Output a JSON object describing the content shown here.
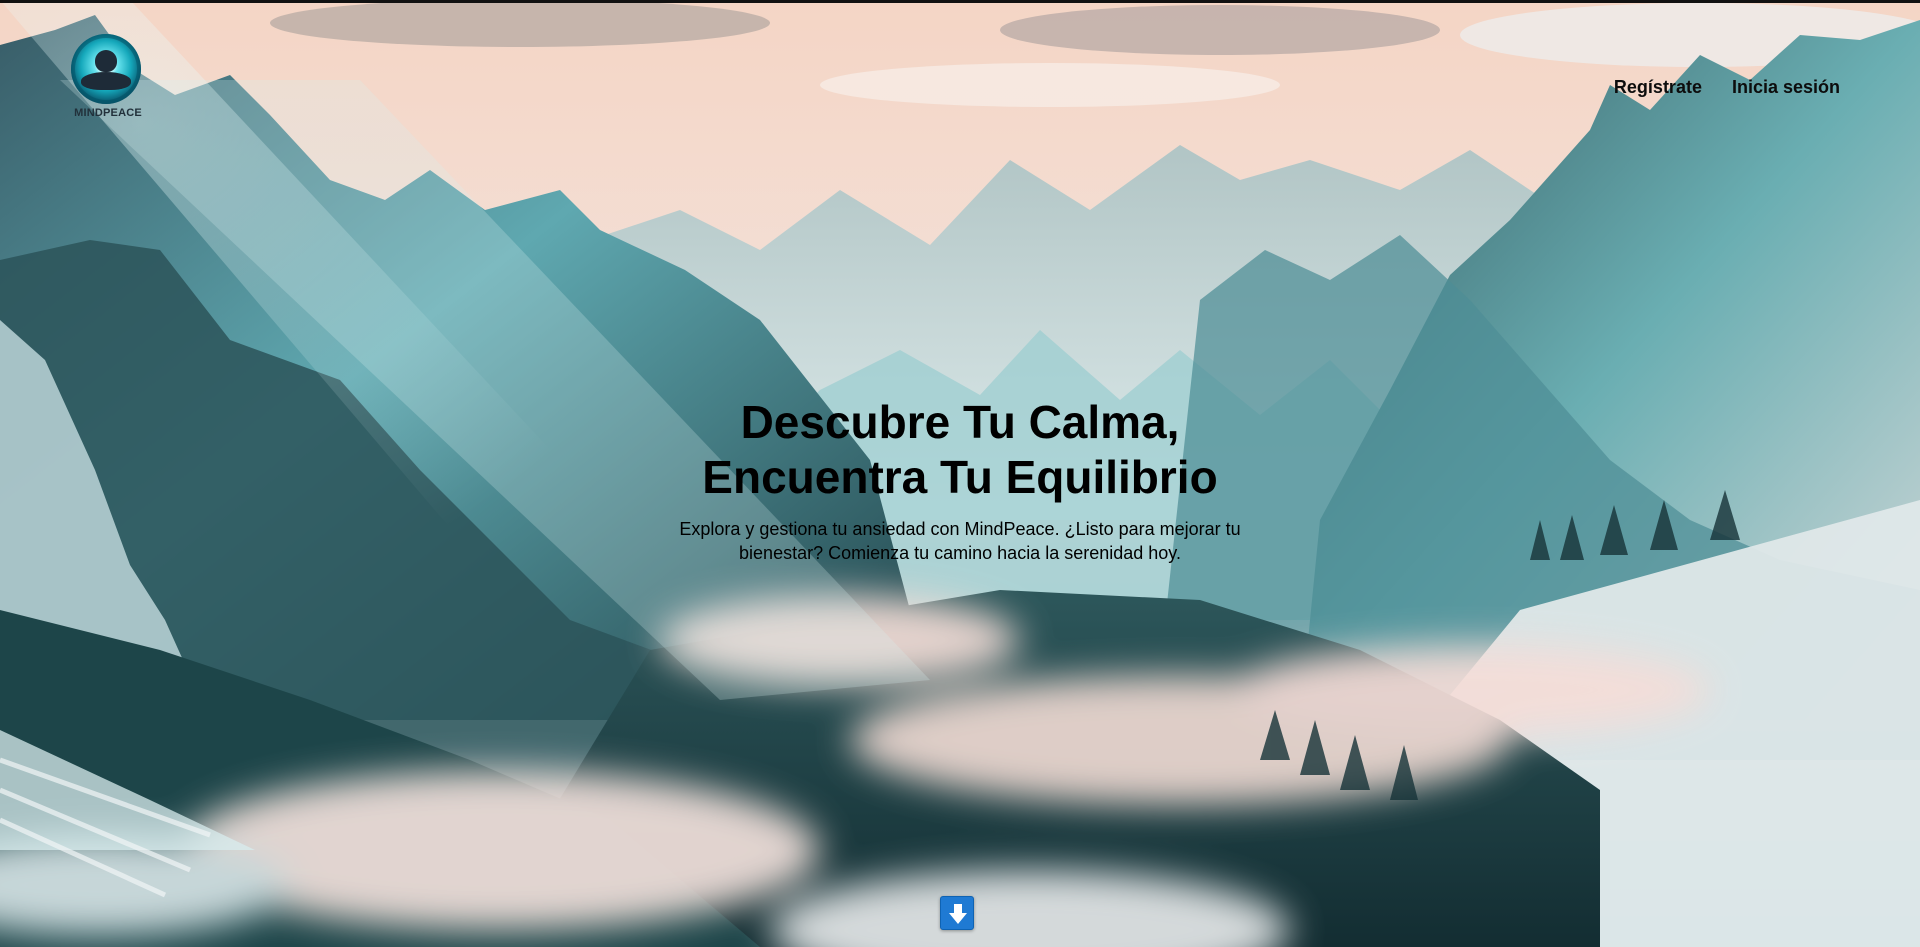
{
  "brand": {
    "name": "MINDPEACE"
  },
  "nav": {
    "register": "Regístrate",
    "login": "Inicia sesión"
  },
  "hero": {
    "title_line_1": "Descubre Tu Calma,",
    "title_line_2": "Encuentra Tu Equilibrio",
    "description_line_1": "Explora y gestiona tu ansiedad con MindPeace. ¿Listo para mejorar tu",
    "description_line_2": "bienestar? Comienza tu camino hacia la serenidad hoy."
  },
  "scroll": {
    "icon": "down-arrow-icon"
  },
  "colors": {
    "accent_blue": "#1f7ad3",
    "text_dark": "#000000",
    "sky": "#f1d8c9",
    "mountain_teal": "#3d6b70"
  }
}
